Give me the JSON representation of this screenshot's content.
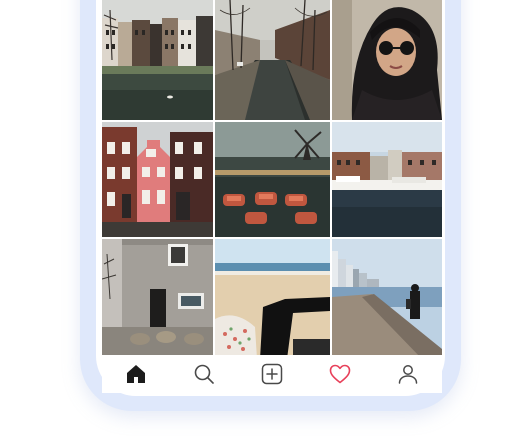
{
  "feed": {
    "photos": [
      {
        "subject": "canal-houses-with-swan"
      },
      {
        "subject": "canal-street-with-trees"
      },
      {
        "subject": "portrait-woman-sunglasses-headscarf"
      },
      {
        "subject": "pink-brick-house-facade"
      },
      {
        "subject": "windmill-with-pedal-boats"
      },
      {
        "subject": "harbor-with-boats"
      },
      {
        "subject": "grey-house-wall"
      },
      {
        "subject": "beach-picnic-legs"
      },
      {
        "subject": "pier-person-walking"
      }
    ]
  },
  "tabbar": {
    "items": [
      {
        "icon": "home-icon",
        "active": true
      },
      {
        "icon": "search-icon",
        "active": false
      },
      {
        "icon": "add-post-icon",
        "active": false
      },
      {
        "icon": "heart-icon",
        "active": false
      },
      {
        "icon": "profile-icon",
        "active": false
      }
    ],
    "colors": {
      "active": "#1c1c1c",
      "inactive": "#4a4a4a",
      "heart": "#e8405a"
    }
  }
}
